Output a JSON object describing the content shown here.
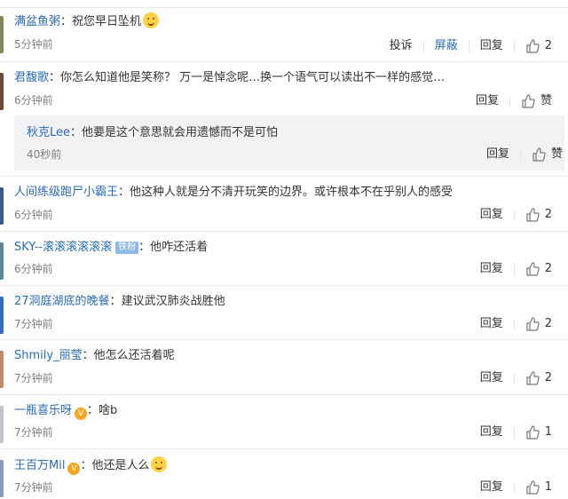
{
  "labels": {
    "report": "投诉",
    "block": "屏蔽",
    "reply": "回复",
    "like": "赞",
    "colon": "："
  },
  "comments": [
    {
      "user": "满盆鱼粥",
      "text": "祝您早日坠机",
      "time": "5分钟前",
      "likes": "2",
      "emoji": true,
      "avatar_color": "#7a8c5a"
    },
    {
      "user": "君馥歌",
      "text": "你怎么知道他是笑称？ 万一是悼念呢…换一个语气可以读出不一样的感觉…",
      "time": "6分钟前",
      "likes": "赞",
      "avatar_color": "#6b4a3a"
    },
    {
      "user": "秋克Lee",
      "text": "他要是这个意思就会用遗憾而不是可怕",
      "time": "40秒前",
      "likes": "赞"
    },
    {
      "user": "人间练级跑尸小霸王",
      "text": "他这种人就是分不清开玩笑的边界。或许根本不在乎别人的感受",
      "time": "6分钟前",
      "likes": "2",
      "avatar_color": "#3a5a8a"
    },
    {
      "user": "SKY--滚滚滚滚滚滚",
      "badge": "铁粉",
      "text": "他咋还活着",
      "time": "6分钟前",
      "likes": "2",
      "avatar_color": "#5a8a9a"
    },
    {
      "user": "27洞庭湖底的晚餐",
      "text": "建议武汉肺炎战胜他",
      "time": "7分钟前",
      "likes": "2",
      "avatar_color": "#3a6ab0"
    },
    {
      "user": "Shmily_丽莹",
      "text": "他怎么还活着呢",
      "time": "7分钟前",
      "likes": "2",
      "avatar_color": "#c08a6a"
    },
    {
      "user": "一瓶喜乐呀",
      "vip": true,
      "text": "啥b",
      "time": "7分钟前",
      "likes": "1",
      "avatar_color": "#c0c4cc"
    },
    {
      "user": "王百万Mil",
      "vip": true,
      "text": "他还是人么",
      "time": "7分钟前",
      "likes": "1",
      "emoji": true,
      "avatar_color": "#8a9ac0"
    }
  ]
}
